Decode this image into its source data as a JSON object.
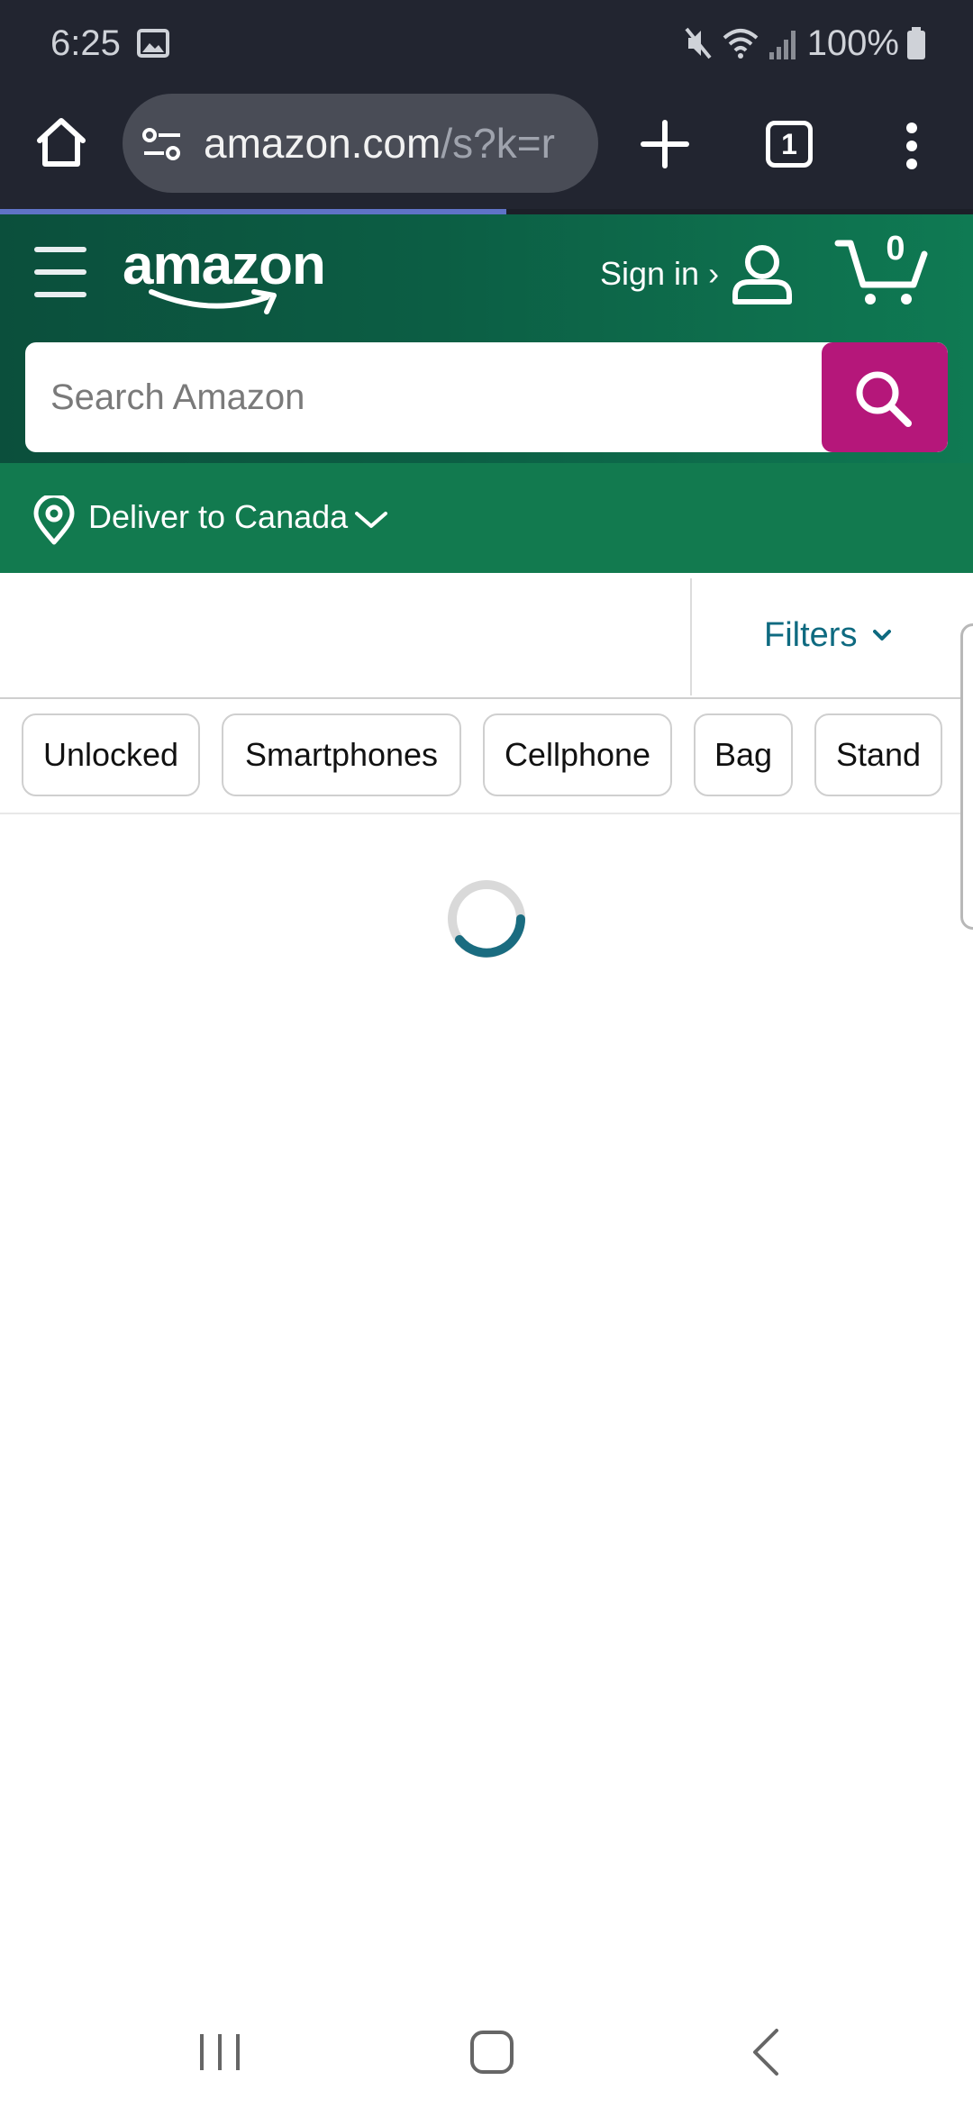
{
  "status_bar": {
    "time": "6:25",
    "battery": "100%"
  },
  "browser": {
    "url_host": "amazon.com",
    "url_path": "/s?k=r",
    "tab_count": "1",
    "page_load_progress": 0.52
  },
  "header": {
    "logo_text": "amazon",
    "signin_label": "Sign in ›",
    "cart_count": "0",
    "search_placeholder": "Search Amazon"
  },
  "deliver": {
    "label": "Deliver to Canada"
  },
  "filters": {
    "label": "Filters"
  },
  "chips": [
    "Unlocked",
    "Smartphones",
    "Cellphone",
    "Bag",
    "Stand"
  ],
  "colors": {
    "header_dark": "#0b4f3c",
    "header_light": "#0f7a53",
    "deliver_bar": "#127a4f",
    "search_button": "#b5177a",
    "filters_text": "#0e6a80",
    "spinner": "#1a6c80"
  },
  "icons": {
    "browser_home": "home-icon",
    "site_settings": "tune-icon",
    "new_tab": "plus-icon",
    "tabs": "tab-switcher-icon",
    "more": "more-vert-icon",
    "menu": "hamburger-icon",
    "account": "user-icon",
    "cart": "cart-icon",
    "search": "search-icon",
    "location": "location-pin-icon",
    "spinner": "loading-spinner"
  }
}
